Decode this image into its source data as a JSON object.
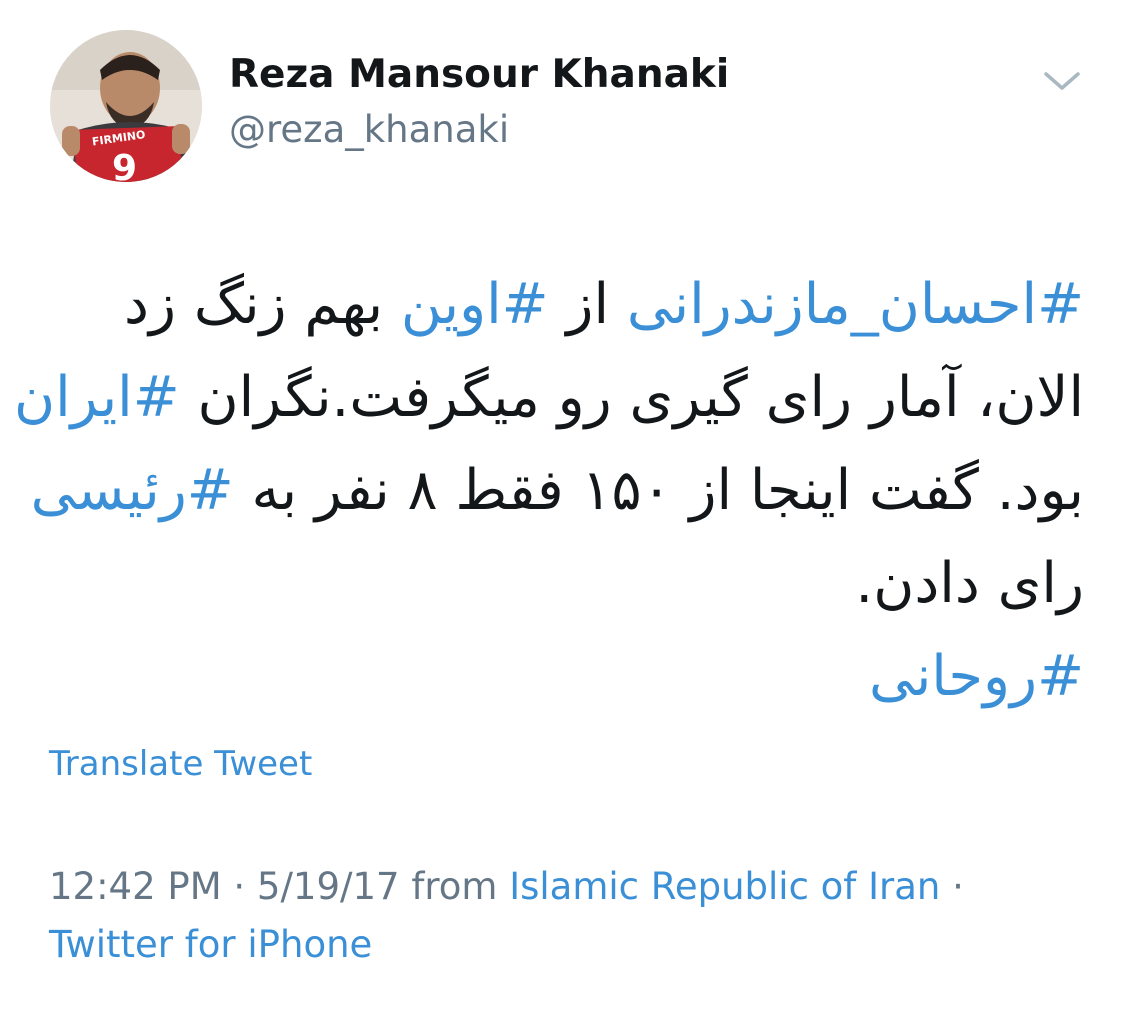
{
  "author": {
    "display_name": "Reza Mansour Khanaki",
    "handle": "@reza_khanaki",
    "avatar_jersey_text": "FIRMINO",
    "avatar_jersey_number": "9"
  },
  "header": {
    "menu_icon": "chevron-down-icon"
  },
  "tweet": {
    "lines": [
      [
        {
          "text": "#احسان_مازندرانی",
          "hashtag": true
        },
        {
          "text": " از ",
          "hashtag": false
        },
        {
          "text": "#اوین",
          "hashtag": true
        },
        {
          "text": " بهم زنگ زد",
          "hashtag": false
        }
      ],
      [
        {
          "text": "الان، آمار رای گیری رو میگرفت.نگران ",
          "hashtag": false
        },
        {
          "text": "#ایران",
          "hashtag": true
        }
      ],
      [
        {
          "text": "بود. گفت اینجا از ۱۵۰ فقط ۸ نفر به ",
          "hashtag": false
        },
        {
          "text": "#رئیسی",
          "hashtag": true
        }
      ],
      [
        {
          "text": "رای دادن.",
          "hashtag": false
        }
      ],
      [
        {
          "text": "#روحانی",
          "hashtag": true
        }
      ]
    ]
  },
  "translate_label": "Translate Tweet",
  "meta": {
    "time": "12:42 PM",
    "sep1": " · ",
    "date": "5/19/17",
    "from": " from ",
    "location": "Islamic Republic of Iran",
    "sep2": " · ",
    "client": "Twitter for iPhone"
  },
  "colors": {
    "link": "#3a8fd6",
    "text": "#14171a",
    "secondary": "#657786"
  }
}
